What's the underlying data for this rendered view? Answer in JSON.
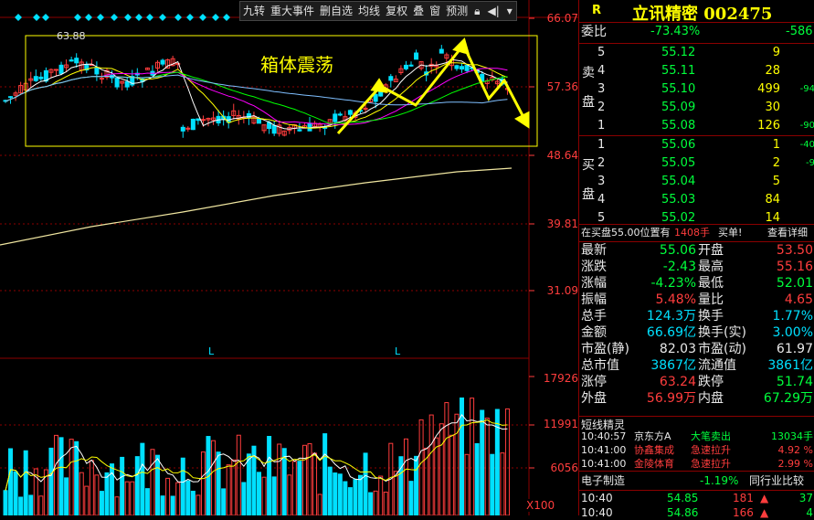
{
  "toolbar": [
    "九转",
    "重大事件",
    "删自选",
    "均线",
    "复权",
    "叠",
    "窗",
    "预测"
  ],
  "toolbar_icons": [
    "lock-icon",
    "prev-icon",
    "dropdown-icon"
  ],
  "price_axis": [
    "66.07",
    "57.36",
    "48.64",
    "39.81",
    "31.09"
  ],
  "volume_axis": [
    "17926",
    "11991",
    "6056",
    "X100"
  ],
  "ma_label": "63.88",
  "annotation": "箱体震荡",
  "l_markers": [
    "L",
    "L"
  ],
  "header": {
    "r": "R",
    "name": "立讯精密 002475"
  },
  "weibi": {
    "label": "委比",
    "value": "-73.43%",
    "diff": "-586"
  },
  "sell_label": [
    "卖",
    "盘"
  ],
  "buy_label": [
    "买",
    "盘"
  ],
  "asks": [
    {
      "n": "5",
      "price": "55.12",
      "vol": "9",
      "chg": ""
    },
    {
      "n": "4",
      "price": "55.11",
      "vol": "28",
      "chg": ""
    },
    {
      "n": "3",
      "price": "55.10",
      "vol": "499",
      "chg": "-94"
    },
    {
      "n": "2",
      "price": "55.09",
      "vol": "30",
      "chg": ""
    },
    {
      "n": "1",
      "price": "55.08",
      "vol": "126",
      "chg": "-90"
    }
  ],
  "bids": [
    {
      "n": "1",
      "price": "55.06",
      "vol": "1",
      "chg": "-40"
    },
    {
      "n": "2",
      "price": "55.05",
      "vol": "2",
      "chg": "-9"
    },
    {
      "n": "3",
      "price": "55.04",
      "vol": "5",
      "chg": ""
    },
    {
      "n": "4",
      "price": "55.03",
      "vol": "84",
      "chg": ""
    },
    {
      "n": "5",
      "price": "55.02",
      "vol": "14",
      "chg": ""
    }
  ],
  "note": {
    "text": "在买盘55.00位置有",
    "qty": "1408手",
    "buy": "买单!",
    "detail": "查看详细"
  },
  "stats": [
    [
      "最新",
      "55.06",
      "开盘",
      "53.50"
    ],
    [
      "涨跌",
      "-2.43",
      "最高",
      "55.16"
    ],
    [
      "涨幅",
      "-4.23%",
      "最低",
      "52.01"
    ],
    [
      "振幅",
      "5.48%",
      "量比",
      "4.65"
    ],
    [
      "总手",
      "124.3万",
      "换手",
      "1.77%"
    ],
    [
      "金额",
      "66.69亿",
      "换手(实)",
      "3.00%"
    ],
    [
      "市盈(静)",
      "82.03",
      "市盈(动)",
      "61.97"
    ],
    [
      "总市值",
      "3867亿",
      "流通值",
      "3861亿"
    ],
    [
      "涨停",
      "63.24",
      "跌停",
      "51.74"
    ],
    [
      "外盘",
      "56.99万",
      "内盘",
      "67.29万"
    ]
  ],
  "short_title": "短线精灵",
  "short_items": [
    {
      "time": "10:40:57",
      "stock": "京东方A",
      "event": "大笔卖出",
      "val": "13034手"
    },
    {
      "time": "10:41:00",
      "stock": "协鑫集成",
      "event": "急速拉升",
      "val": "4.92 %"
    },
    {
      "time": "10:41:00",
      "stock": "金陵体育",
      "event": "急速拉升",
      "val": "2.99 %"
    }
  ],
  "industry": {
    "name": "电子制造",
    "chg": "-1.19%",
    "compare": "同行业比较"
  },
  "ticks": [
    {
      "time": "10:40",
      "price": "54.85",
      "vol": "181",
      "n": "37"
    },
    {
      "time": "10:40",
      "price": "54.86",
      "vol": "166",
      "n": "4"
    }
  ],
  "colors": {
    "up": "#ff3d3d",
    "down": "#00e0ff",
    "box": "#ffff00",
    "arrow": "#ffff00"
  }
}
